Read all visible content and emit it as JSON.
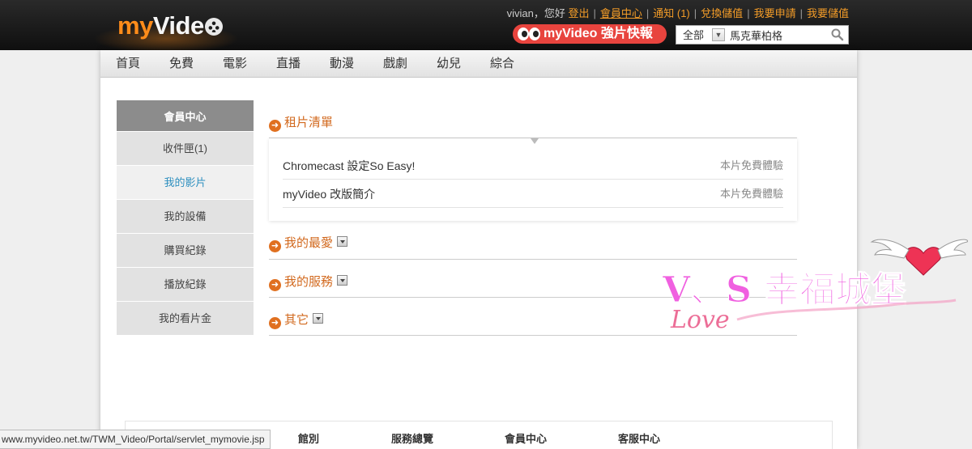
{
  "header": {
    "logo_my": "my",
    "logo_video": "Vide",
    "username": "vivian",
    "greeting": "，您好",
    "links": [
      {
        "label": "登出"
      },
      {
        "label": "會員中心"
      },
      {
        "label": "通知 (1)"
      },
      {
        "label": "兌換儲值"
      },
      {
        "label": "我要申請"
      },
      {
        "label": "我要儲值"
      }
    ],
    "promo_label": "myVideo 強片快報",
    "search": {
      "category": "全部",
      "value": "馬克華柏格"
    }
  },
  "nav": {
    "items": [
      "首頁",
      "免費",
      "電影",
      "直播",
      "動漫",
      "戲劇",
      "幼兒",
      "綜合"
    ]
  },
  "sidebar": {
    "title": "會員中心",
    "items": [
      {
        "label": "收件匣(1)",
        "active": false
      },
      {
        "label": "我的影片",
        "active": true
      },
      {
        "label": "我的設備",
        "active": false
      },
      {
        "label": "購買紀錄",
        "active": false
      },
      {
        "label": "播放紀錄",
        "active": false
      },
      {
        "label": "我的看片金",
        "active": false
      }
    ]
  },
  "main": {
    "rent_list": {
      "title": "租片清單",
      "rows": [
        {
          "title": "Chromecast 設定So Easy!",
          "status": "本片免費體驗"
        },
        {
          "title": "myVideo 改版簡介",
          "status": "本片免費體驗"
        }
      ]
    },
    "sections": [
      {
        "title": "我的最愛"
      },
      {
        "title": "我的服務"
      },
      {
        "title": "其它"
      }
    ]
  },
  "footer": {
    "columns": [
      "館別",
      "服務總覽",
      "會員中心",
      "客服中心"
    ]
  },
  "statusbar": {
    "url": "www.myvideo.net.tw/TWM_Video/Portal/servlet_mymovie.jsp"
  },
  "watermark": {
    "text": "V、S 幸福城堡",
    "script_text": "Love"
  },
  "colors": {
    "accent": "#f39c28",
    "section_title": "#d2691e",
    "active_link": "#2d8fbf",
    "promo": "#e8443e"
  }
}
